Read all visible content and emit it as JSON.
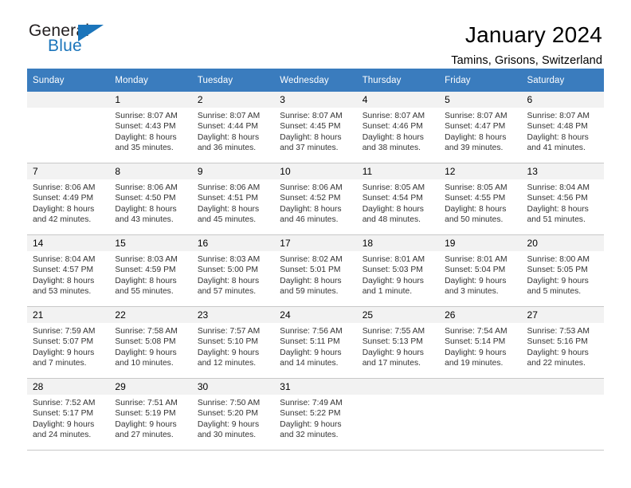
{
  "logo": {
    "word_top": "General",
    "word_bottom": "Blue",
    "accent_color": "#1b75bb"
  },
  "header": {
    "title": "January 2024",
    "subtitle": "Tamins, Grisons, Switzerland"
  },
  "calendar": {
    "header_bg": "#3a7cbe",
    "daynum_bg": "#f2f2f2",
    "weekday_headers": [
      "Sunday",
      "Monday",
      "Tuesday",
      "Wednesday",
      "Thursday",
      "Friday",
      "Saturday"
    ],
    "labels": {
      "sunrise": "Sunrise:",
      "sunset": "Sunset:",
      "daylight": "Daylight:"
    },
    "weeks": [
      [
        {
          "day": "",
          "empty": true
        },
        {
          "day": "1",
          "sunrise": "Sunrise: 8:07 AM",
          "sunset": "Sunset: 4:43 PM",
          "daylight1": "Daylight: 8 hours",
          "daylight2": "and 35 minutes."
        },
        {
          "day": "2",
          "sunrise": "Sunrise: 8:07 AM",
          "sunset": "Sunset: 4:44 PM",
          "daylight1": "Daylight: 8 hours",
          "daylight2": "and 36 minutes."
        },
        {
          "day": "3",
          "sunrise": "Sunrise: 8:07 AM",
          "sunset": "Sunset: 4:45 PM",
          "daylight1": "Daylight: 8 hours",
          "daylight2": "and 37 minutes."
        },
        {
          "day": "4",
          "sunrise": "Sunrise: 8:07 AM",
          "sunset": "Sunset: 4:46 PM",
          "daylight1": "Daylight: 8 hours",
          "daylight2": "and 38 minutes."
        },
        {
          "day": "5",
          "sunrise": "Sunrise: 8:07 AM",
          "sunset": "Sunset: 4:47 PM",
          "daylight1": "Daylight: 8 hours",
          "daylight2": "and 39 minutes."
        },
        {
          "day": "6",
          "sunrise": "Sunrise: 8:07 AM",
          "sunset": "Sunset: 4:48 PM",
          "daylight1": "Daylight: 8 hours",
          "daylight2": "and 41 minutes."
        }
      ],
      [
        {
          "day": "7",
          "sunrise": "Sunrise: 8:06 AM",
          "sunset": "Sunset: 4:49 PM",
          "daylight1": "Daylight: 8 hours",
          "daylight2": "and 42 minutes."
        },
        {
          "day": "8",
          "sunrise": "Sunrise: 8:06 AM",
          "sunset": "Sunset: 4:50 PM",
          "daylight1": "Daylight: 8 hours",
          "daylight2": "and 43 minutes."
        },
        {
          "day": "9",
          "sunrise": "Sunrise: 8:06 AM",
          "sunset": "Sunset: 4:51 PM",
          "daylight1": "Daylight: 8 hours",
          "daylight2": "and 45 minutes."
        },
        {
          "day": "10",
          "sunrise": "Sunrise: 8:06 AM",
          "sunset": "Sunset: 4:52 PM",
          "daylight1": "Daylight: 8 hours",
          "daylight2": "and 46 minutes."
        },
        {
          "day": "11",
          "sunrise": "Sunrise: 8:05 AM",
          "sunset": "Sunset: 4:54 PM",
          "daylight1": "Daylight: 8 hours",
          "daylight2": "and 48 minutes."
        },
        {
          "day": "12",
          "sunrise": "Sunrise: 8:05 AM",
          "sunset": "Sunset: 4:55 PM",
          "daylight1": "Daylight: 8 hours",
          "daylight2": "and 50 minutes."
        },
        {
          "day": "13",
          "sunrise": "Sunrise: 8:04 AM",
          "sunset": "Sunset: 4:56 PM",
          "daylight1": "Daylight: 8 hours",
          "daylight2": "and 51 minutes."
        }
      ],
      [
        {
          "day": "14",
          "sunrise": "Sunrise: 8:04 AM",
          "sunset": "Sunset: 4:57 PM",
          "daylight1": "Daylight: 8 hours",
          "daylight2": "and 53 minutes."
        },
        {
          "day": "15",
          "sunrise": "Sunrise: 8:03 AM",
          "sunset": "Sunset: 4:59 PM",
          "daylight1": "Daylight: 8 hours",
          "daylight2": "and 55 minutes."
        },
        {
          "day": "16",
          "sunrise": "Sunrise: 8:03 AM",
          "sunset": "Sunset: 5:00 PM",
          "daylight1": "Daylight: 8 hours",
          "daylight2": "and 57 minutes."
        },
        {
          "day": "17",
          "sunrise": "Sunrise: 8:02 AM",
          "sunset": "Sunset: 5:01 PM",
          "daylight1": "Daylight: 8 hours",
          "daylight2": "and 59 minutes."
        },
        {
          "day": "18",
          "sunrise": "Sunrise: 8:01 AM",
          "sunset": "Sunset: 5:03 PM",
          "daylight1": "Daylight: 9 hours",
          "daylight2": "and 1 minute."
        },
        {
          "day": "19",
          "sunrise": "Sunrise: 8:01 AM",
          "sunset": "Sunset: 5:04 PM",
          "daylight1": "Daylight: 9 hours",
          "daylight2": "and 3 minutes."
        },
        {
          "day": "20",
          "sunrise": "Sunrise: 8:00 AM",
          "sunset": "Sunset: 5:05 PM",
          "daylight1": "Daylight: 9 hours",
          "daylight2": "and 5 minutes."
        }
      ],
      [
        {
          "day": "21",
          "sunrise": "Sunrise: 7:59 AM",
          "sunset": "Sunset: 5:07 PM",
          "daylight1": "Daylight: 9 hours",
          "daylight2": "and 7 minutes."
        },
        {
          "day": "22",
          "sunrise": "Sunrise: 7:58 AM",
          "sunset": "Sunset: 5:08 PM",
          "daylight1": "Daylight: 9 hours",
          "daylight2": "and 10 minutes."
        },
        {
          "day": "23",
          "sunrise": "Sunrise: 7:57 AM",
          "sunset": "Sunset: 5:10 PM",
          "daylight1": "Daylight: 9 hours",
          "daylight2": "and 12 minutes."
        },
        {
          "day": "24",
          "sunrise": "Sunrise: 7:56 AM",
          "sunset": "Sunset: 5:11 PM",
          "daylight1": "Daylight: 9 hours",
          "daylight2": "and 14 minutes."
        },
        {
          "day": "25",
          "sunrise": "Sunrise: 7:55 AM",
          "sunset": "Sunset: 5:13 PM",
          "daylight1": "Daylight: 9 hours",
          "daylight2": "and 17 minutes."
        },
        {
          "day": "26",
          "sunrise": "Sunrise: 7:54 AM",
          "sunset": "Sunset: 5:14 PM",
          "daylight1": "Daylight: 9 hours",
          "daylight2": "and 19 minutes."
        },
        {
          "day": "27",
          "sunrise": "Sunrise: 7:53 AM",
          "sunset": "Sunset: 5:16 PM",
          "daylight1": "Daylight: 9 hours",
          "daylight2": "and 22 minutes."
        }
      ],
      [
        {
          "day": "28",
          "sunrise": "Sunrise: 7:52 AM",
          "sunset": "Sunset: 5:17 PM",
          "daylight1": "Daylight: 9 hours",
          "daylight2": "and 24 minutes."
        },
        {
          "day": "29",
          "sunrise": "Sunrise: 7:51 AM",
          "sunset": "Sunset: 5:19 PM",
          "daylight1": "Daylight: 9 hours",
          "daylight2": "and 27 minutes."
        },
        {
          "day": "30",
          "sunrise": "Sunrise: 7:50 AM",
          "sunset": "Sunset: 5:20 PM",
          "daylight1": "Daylight: 9 hours",
          "daylight2": "and 30 minutes."
        },
        {
          "day": "31",
          "sunrise": "Sunrise: 7:49 AM",
          "sunset": "Sunset: 5:22 PM",
          "daylight1": "Daylight: 9 hours",
          "daylight2": "and 32 minutes."
        },
        {
          "day": "",
          "empty": true
        },
        {
          "day": "",
          "empty": true
        },
        {
          "day": "",
          "empty": true
        }
      ]
    ]
  }
}
